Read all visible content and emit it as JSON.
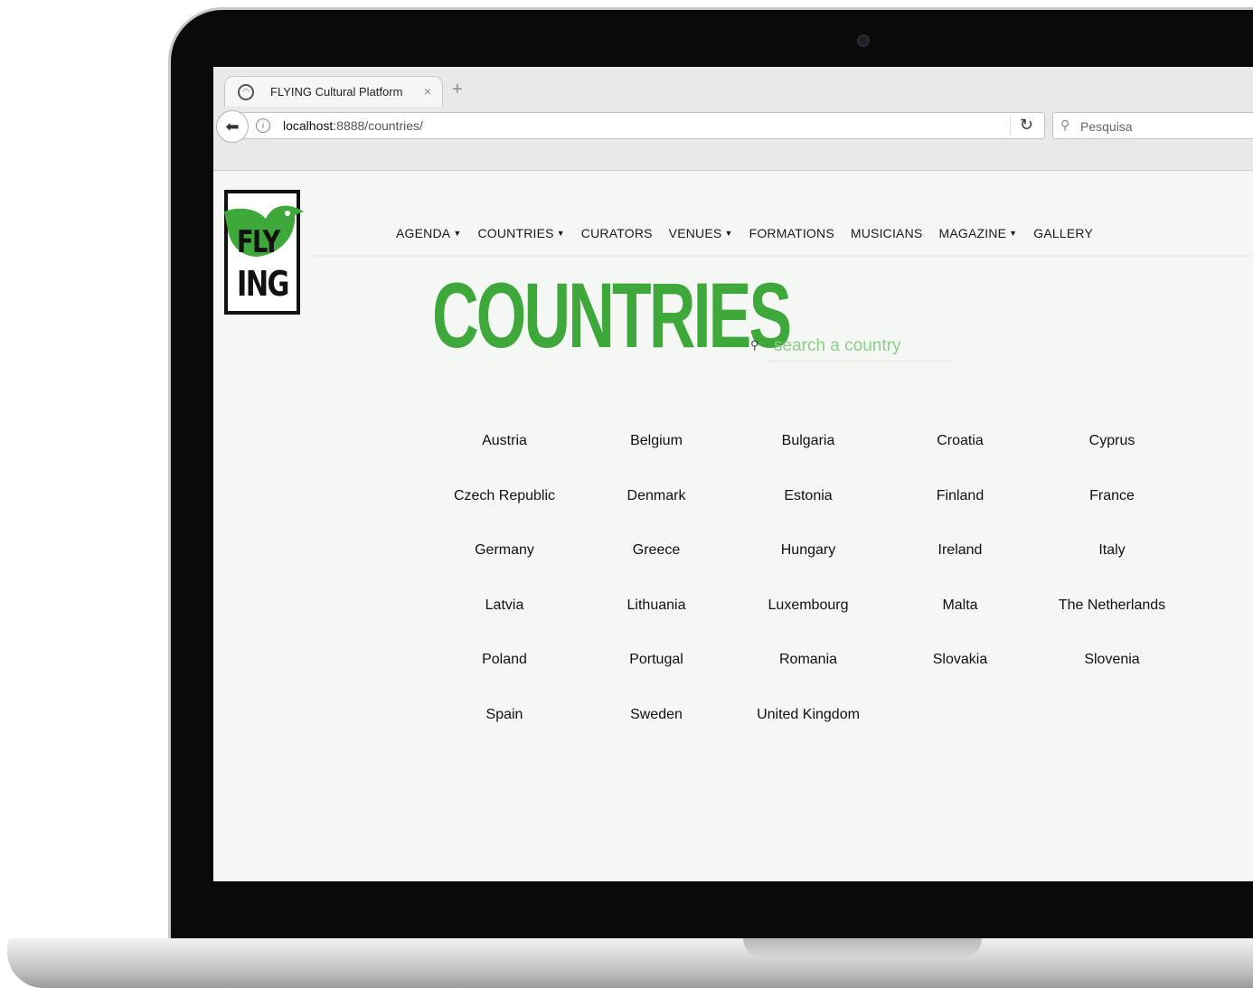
{
  "browser": {
    "tab_title": "FLYING Cultural Platform",
    "tab_close": "×",
    "new_tab": "+",
    "url_host": "localhost",
    "url_path": ":8888/countries/",
    "search_placeholder": "Pesquisa"
  },
  "logo": {
    "line1": "FLY",
    "line2": "ING"
  },
  "nav": {
    "items": [
      {
        "label": "AGENDA",
        "has_dropdown": true
      },
      {
        "label": "COUNTRIES",
        "has_dropdown": true
      },
      {
        "label": "CURATORS",
        "has_dropdown": false
      },
      {
        "label": "VENUES",
        "has_dropdown": true
      },
      {
        "label": "FORMATIONS",
        "has_dropdown": false
      },
      {
        "label": "MUSICIANS",
        "has_dropdown": false
      },
      {
        "label": "MAGAZINE",
        "has_dropdown": true
      },
      {
        "label": "GALLERY",
        "has_dropdown": false
      }
    ]
  },
  "main": {
    "title": "COUNTRIES",
    "search_placeholder": "search a country",
    "countries": [
      "Austria",
      "Belgium",
      "Bulgaria",
      "Croatia",
      "Cyprus",
      "Czech Republic",
      "Denmark",
      "Estonia",
      "Finland",
      "France",
      "Germany",
      "Greece",
      "Hungary",
      "Ireland",
      "Italy",
      "Latvia",
      "Lithuania",
      "Luxembourg",
      "Malta",
      "The Netherlands",
      "Poland",
      "Portugal",
      "Romania",
      "Slovakia",
      "Slovenia",
      "Spain",
      "Sweden",
      "United Kingdom"
    ]
  },
  "colors": {
    "accent": "#3fa83a",
    "page_bg": "#f4f7f4"
  }
}
